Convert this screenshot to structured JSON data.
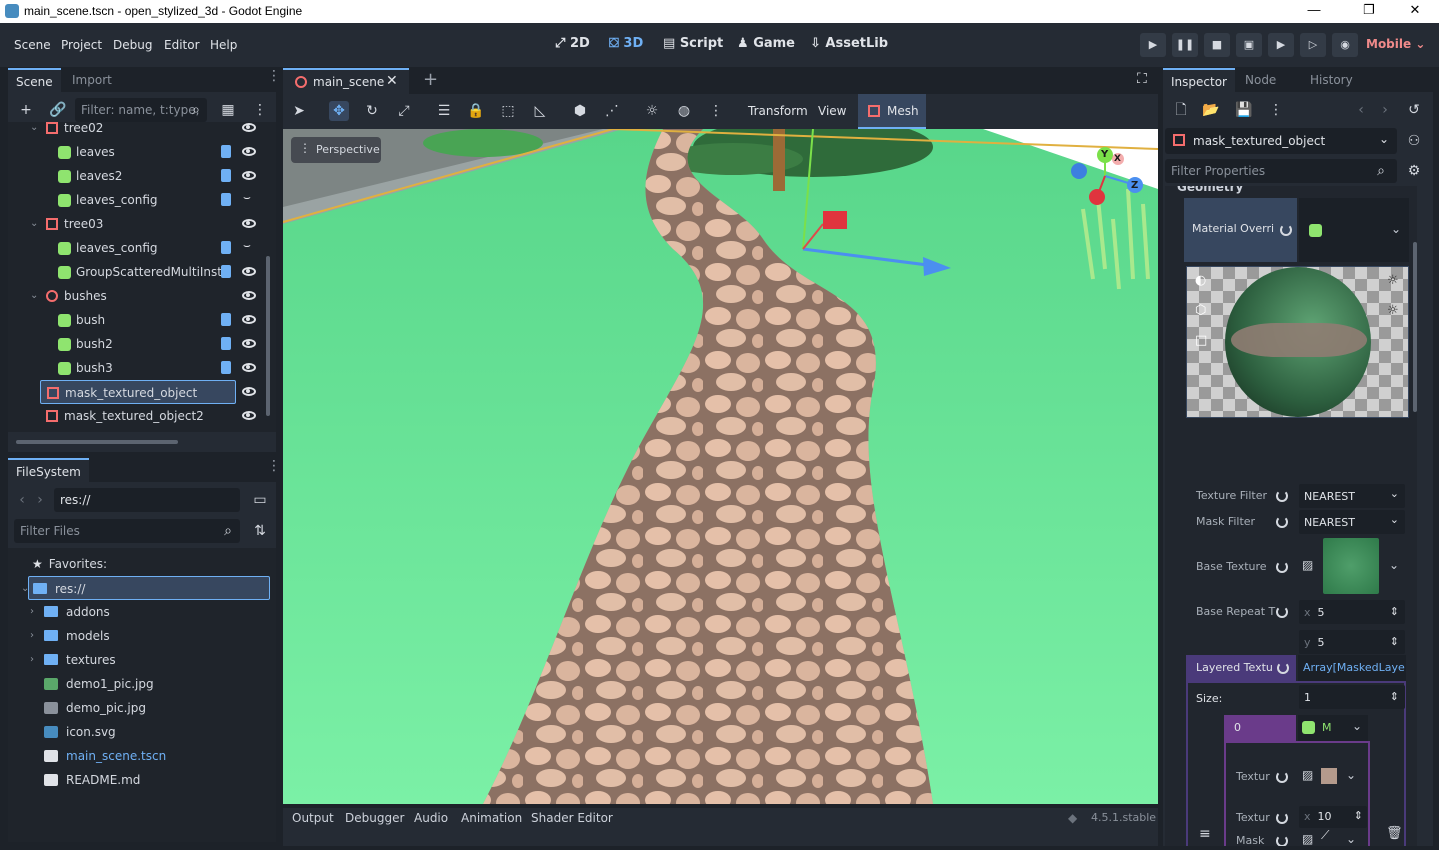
{
  "window": {
    "title": "main_scene.tscn - open_stylized_3d - Godot Engine",
    "controls": [
      "—",
      "❐",
      "✕"
    ]
  },
  "menu": {
    "items": [
      "Scene",
      "Project",
      "Debug",
      "Editor",
      "Help"
    ]
  },
  "workspaces": [
    "2D",
    "3D",
    "Script",
    "Game",
    "AssetLib"
  ],
  "renderer": "Mobile",
  "scene_dock": {
    "tabs": [
      "Scene",
      "Import"
    ],
    "filter_placeholder": "Filter: name, t:type,",
    "nodes": [
      {
        "label": "tree02",
        "type": "3d",
        "indent": 0,
        "expanded": true,
        "script": false,
        "vis": "eye"
      },
      {
        "label": "leaves",
        "type": "mesh",
        "indent": 1,
        "script": true,
        "vis": "eye"
      },
      {
        "label": "leaves2",
        "type": "mesh",
        "indent": 1,
        "script": true,
        "vis": "eye"
      },
      {
        "label": "leaves_config",
        "type": "mesh",
        "indent": 1,
        "script": true,
        "vis": "closed"
      },
      {
        "label": "tree03",
        "type": "3d",
        "indent": 0,
        "expanded": true,
        "script": false,
        "vis": "eye"
      },
      {
        "label": "leaves_config",
        "type": "mesh",
        "indent": 1,
        "script": true,
        "vis": "closed"
      },
      {
        "label": "GroupScatteredMultiInst",
        "type": "mesh",
        "indent": 1,
        "script": true,
        "vis": "eye"
      },
      {
        "label": "bushes",
        "type": "circle",
        "indent": 0,
        "expanded": true,
        "script": false,
        "vis": "eye"
      },
      {
        "label": "bush",
        "type": "mesh",
        "indent": 1,
        "script": true,
        "vis": "eye"
      },
      {
        "label": "bush2",
        "type": "mesh",
        "indent": 1,
        "script": true,
        "vis": "eye"
      },
      {
        "label": "bush3",
        "type": "mesh",
        "indent": 1,
        "script": true,
        "vis": "eye"
      },
      {
        "label": "mask_textured_object",
        "type": "3d",
        "indent": 0,
        "selected": true,
        "script": false,
        "vis": "eye"
      },
      {
        "label": "mask_textured_object2",
        "type": "3d",
        "indent": 0,
        "script": false,
        "vis": "eye"
      }
    ]
  },
  "filesystem": {
    "tab": "FileSystem",
    "path": "res://",
    "filter_placeholder": "Filter Files",
    "favorites": "Favorites:",
    "items": [
      {
        "label": "res://",
        "kind": "folder",
        "indent": 0,
        "selected": true
      },
      {
        "label": "addons",
        "kind": "folder",
        "indent": 1
      },
      {
        "label": "models",
        "kind": "folder",
        "indent": 1
      },
      {
        "label": "textures",
        "kind": "folder",
        "indent": 1
      },
      {
        "label": "demo1_pic.jpg",
        "kind": "image",
        "indent": 1
      },
      {
        "label": "demo_pic.jpg",
        "kind": "image2",
        "indent": 1
      },
      {
        "label": "icon.svg",
        "kind": "svg",
        "indent": 1
      },
      {
        "label": "main_scene.tscn",
        "kind": "scene",
        "indent": 1,
        "highlight": true
      },
      {
        "label": "README.md",
        "kind": "text",
        "indent": 1
      }
    ]
  },
  "editor": {
    "scene_tab": "main_scene",
    "toolbar_labels": [
      "Transform",
      "View",
      "Mesh"
    ],
    "viewport_label": "Perspective",
    "gizmo_axes": [
      "Y",
      "Z",
      "X"
    ]
  },
  "bottom": {
    "tabs": [
      "Output",
      "Debugger",
      "Audio",
      "Animation",
      "Shader Editor"
    ],
    "version": "4.5.1.stable"
  },
  "inspector": {
    "tabs": [
      "Inspector",
      "Node",
      "History"
    ],
    "object_name": "mask_textured_object",
    "filter_placeholder": "Filter Properties",
    "section": "Geometry",
    "material_override_label": "Material Overri",
    "texture_filter": {
      "label": "Texture Filter",
      "value": "NEAREST"
    },
    "mask_filter": {
      "label": "Mask Filter",
      "value": "NEAREST"
    },
    "base_texture_label": "Base Texture",
    "base_repeat": {
      "label": "Base Repeat T",
      "x": "5",
      "y": "5"
    },
    "layered": {
      "label": "Layered Textu",
      "value": "Array[MaskedLaye"
    },
    "size": {
      "label": "Size:",
      "value": "1"
    },
    "element": {
      "index": "0",
      "value": "M"
    },
    "sub": {
      "texture_label": "Textur",
      "mask_label": "Mask",
      "texture2_label": "Textur",
      "texture2_x": "10"
    }
  }
}
